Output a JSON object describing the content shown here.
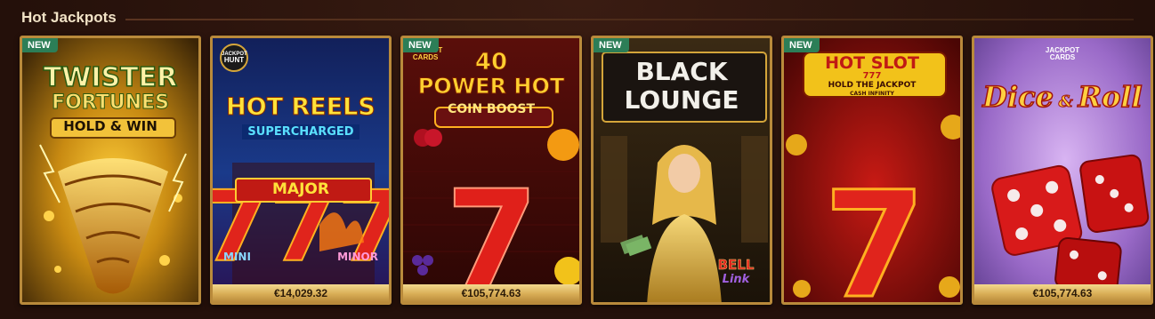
{
  "section": {
    "title": "Hot Jackpots"
  },
  "cards": [
    {
      "new_label": "NEW",
      "title_line1": "TWISTER",
      "title_line2": "FORTUNES",
      "title_line3": "HOLD & WIN"
    },
    {
      "logo_line1": "JACKPOT",
      "logo_line2": "HUNT",
      "title_line1": "HOT REELS",
      "title_line2": "SUPERCHARGED",
      "label_major": "MAJOR",
      "label_mini": "MINI",
      "label_minor": "MINOR",
      "jackpot": "€14,029.32"
    },
    {
      "new_label": "NEW",
      "logo_line1": "JACKPOT",
      "logo_line2": "CARDS",
      "title_line1": "40",
      "title_line2": "POWER HOT",
      "title_line3": "COIN BOOST",
      "jackpot": "€105,774.63"
    },
    {
      "new_label": "NEW",
      "title_line1": "BLACK",
      "title_line2": "LOUNGE",
      "brand_line1": "BELL",
      "brand_line2": "Link"
    },
    {
      "new_label": "NEW",
      "title_line1": "HOT SLOT",
      "title_line2": "777",
      "title_line3": "HOLD THE JACKPOT",
      "title_line4": "CASH INFINITY"
    },
    {
      "logo_line1": "JACKPOT",
      "logo_line2": "CARDS",
      "title_line1": "Dice",
      "title_amp": "&",
      "title_line2": "Roll",
      "jackpot": "€105,774.63"
    }
  ],
  "colors": {
    "frame": "#b98a3b",
    "new_badge": "#2c7e57",
    "header_text": "#f1e2c6",
    "background": "#2a130c"
  }
}
